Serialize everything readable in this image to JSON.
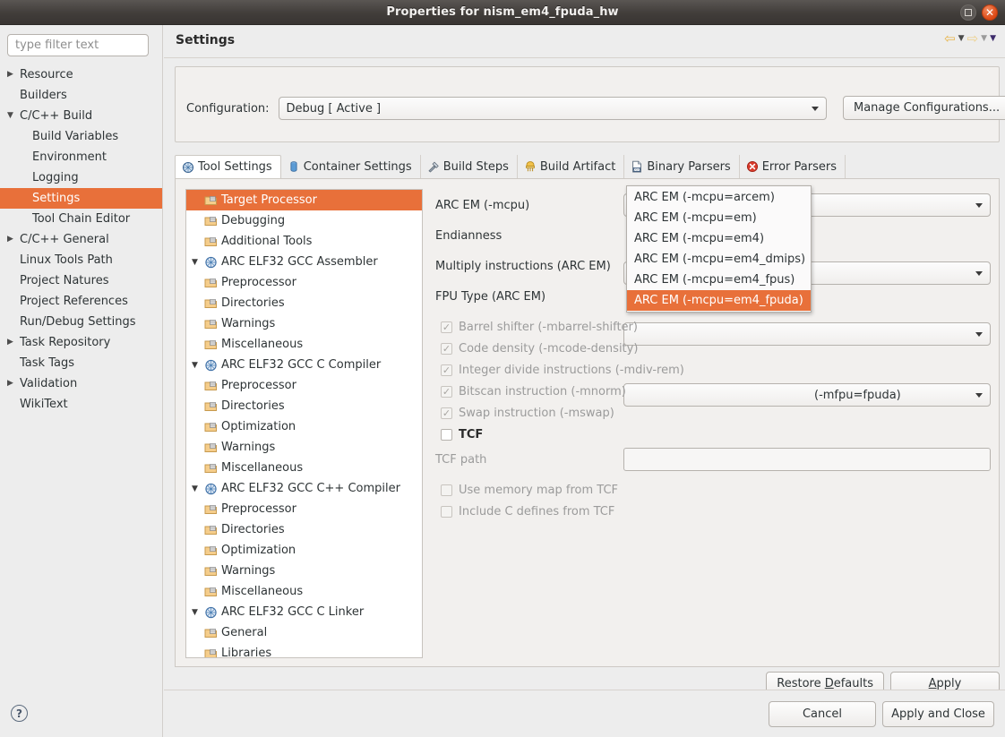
{
  "window": {
    "title": "Properties for nism_em4_fpuda_hw",
    "maximize_icon": "maximize-icon",
    "close_icon": "close-icon"
  },
  "sidebar": {
    "filter_placeholder": "type filter text",
    "filter_value": "",
    "items": [
      {
        "label": "Resource",
        "twisty": "▶",
        "indent": 0,
        "selected": false
      },
      {
        "label": "Builders",
        "twisty": "",
        "indent": 0,
        "selected": false
      },
      {
        "label": "C/C++ Build",
        "twisty": "▼",
        "indent": 0,
        "selected": false
      },
      {
        "label": "Build Variables",
        "twisty": "",
        "indent": 1,
        "selected": false
      },
      {
        "label": "Environment",
        "twisty": "",
        "indent": 1,
        "selected": false
      },
      {
        "label": "Logging",
        "twisty": "",
        "indent": 1,
        "selected": false
      },
      {
        "label": "Settings",
        "twisty": "",
        "indent": 1,
        "selected": true
      },
      {
        "label": "Tool Chain Editor",
        "twisty": "",
        "indent": 1,
        "selected": false
      },
      {
        "label": "C/C++ General",
        "twisty": "▶",
        "indent": 0,
        "selected": false
      },
      {
        "label": "Linux Tools Path",
        "twisty": "",
        "indent": 0,
        "selected": false
      },
      {
        "label": "Project Natures",
        "twisty": "",
        "indent": 0,
        "selected": false
      },
      {
        "label": "Project References",
        "twisty": "",
        "indent": 0,
        "selected": false
      },
      {
        "label": "Run/Debug Settings",
        "twisty": "",
        "indent": 0,
        "selected": false
      },
      {
        "label": "Task Repository",
        "twisty": "▶",
        "indent": 0,
        "selected": false
      },
      {
        "label": "Task Tags",
        "twisty": "",
        "indent": 0,
        "selected": false
      },
      {
        "label": "Validation",
        "twisty": "▶",
        "indent": 0,
        "selected": false
      },
      {
        "label": "WikiText",
        "twisty": "",
        "indent": 0,
        "selected": false
      }
    ],
    "help_icon": "help-icon",
    "help_glyph": "?"
  },
  "page": {
    "title": "Settings",
    "nav": [
      {
        "name": "back-arrow-icon",
        "glyph": "⇦"
      },
      {
        "name": "back-dropdown-icon",
        "glyph": "▼"
      },
      {
        "name": "forward-arrow-icon",
        "glyph": "⇨"
      },
      {
        "name": "forward-dropdown-icon",
        "glyph": "▼"
      },
      {
        "name": "view-menu-icon",
        "glyph": "▼"
      }
    ]
  },
  "configuration": {
    "label": "Configuration:",
    "value": "Debug  [ Active ]",
    "manage_button": "Manage Configurations..."
  },
  "tabs": [
    {
      "label": "Tool Settings",
      "icon": "tool-settings-icon",
      "active": true
    },
    {
      "label": "Container Settings",
      "icon": "container-settings-icon",
      "active": false
    },
    {
      "label": "Build Steps",
      "icon": "build-steps-icon",
      "active": false
    },
    {
      "label": "Build Artifact",
      "icon": "build-artifact-icon",
      "active": false
    },
    {
      "label": "Binary Parsers",
      "icon": "binary-parsers-icon",
      "active": false
    },
    {
      "label": "Error Parsers",
      "icon": "error-parsers-icon",
      "active": false
    }
  ],
  "tool_tree": [
    {
      "label": "Target Processor",
      "twisty": "",
      "icon": "folder-icon",
      "indent": 1,
      "selected": true
    },
    {
      "label": "Debugging",
      "twisty": "",
      "icon": "folder-icon",
      "indent": 1,
      "selected": false
    },
    {
      "label": "Additional Tools",
      "twisty": "",
      "icon": "folder-icon",
      "indent": 1,
      "selected": false
    },
    {
      "label": "ARC ELF32 GCC Assembler",
      "twisty": "▼",
      "icon": "tool-icon",
      "indent": 0,
      "selected": false
    },
    {
      "label": "Preprocessor",
      "twisty": "",
      "icon": "folder-icon",
      "indent": 1,
      "selected": false
    },
    {
      "label": "Directories",
      "twisty": "",
      "icon": "folder-icon",
      "indent": 1,
      "selected": false
    },
    {
      "label": "Warnings",
      "twisty": "",
      "icon": "folder-icon",
      "indent": 1,
      "selected": false
    },
    {
      "label": "Miscellaneous",
      "twisty": "",
      "icon": "folder-icon",
      "indent": 1,
      "selected": false
    },
    {
      "label": "ARC ELF32 GCC C Compiler",
      "twisty": "▼",
      "icon": "tool-icon",
      "indent": 0,
      "selected": false
    },
    {
      "label": "Preprocessor",
      "twisty": "",
      "icon": "folder-icon",
      "indent": 1,
      "selected": false
    },
    {
      "label": "Directories",
      "twisty": "",
      "icon": "folder-icon",
      "indent": 1,
      "selected": false
    },
    {
      "label": "Optimization",
      "twisty": "",
      "icon": "folder-icon",
      "indent": 1,
      "selected": false
    },
    {
      "label": "Warnings",
      "twisty": "",
      "icon": "folder-icon",
      "indent": 1,
      "selected": false
    },
    {
      "label": "Miscellaneous",
      "twisty": "",
      "icon": "folder-icon",
      "indent": 1,
      "selected": false
    },
    {
      "label": "ARC ELF32 GCC C++ Compiler",
      "twisty": "▼",
      "icon": "tool-icon",
      "indent": 0,
      "selected": false
    },
    {
      "label": "Preprocessor",
      "twisty": "",
      "icon": "folder-icon",
      "indent": 1,
      "selected": false
    },
    {
      "label": "Directories",
      "twisty": "",
      "icon": "folder-icon",
      "indent": 1,
      "selected": false
    },
    {
      "label": "Optimization",
      "twisty": "",
      "icon": "folder-icon",
      "indent": 1,
      "selected": false
    },
    {
      "label": "Warnings",
      "twisty": "",
      "icon": "folder-icon",
      "indent": 1,
      "selected": false
    },
    {
      "label": "Miscellaneous",
      "twisty": "",
      "icon": "folder-icon",
      "indent": 1,
      "selected": false
    },
    {
      "label": "ARC ELF32 GCC C Linker",
      "twisty": "▼",
      "icon": "tool-icon",
      "indent": 0,
      "selected": false
    },
    {
      "label": "General",
      "twisty": "",
      "icon": "folder-icon",
      "indent": 1,
      "selected": false
    },
    {
      "label": "Libraries",
      "twisty": "",
      "icon": "folder-icon",
      "indent": 1,
      "selected": false
    }
  ],
  "form": {
    "fields": [
      {
        "label": "ARC EM (-mcpu)",
        "value": "ARC EM (-mcpu=em4_fpuda)",
        "disabled": false
      },
      {
        "label": "Endianness",
        "value": "",
        "disabled": false
      },
      {
        "label": "Multiply instructions (ARC EM)",
        "value": "",
        "disabled": false
      },
      {
        "label": "FPU Type (ARC EM)",
        "value": "(-mfpu=fpuda)",
        "disabled": false
      }
    ],
    "checkboxes": [
      {
        "label": "Barrel shifter (-mbarrel-shifter)",
        "checked": true,
        "disabled": true
      },
      {
        "label": "Code density (-mcode-density)",
        "checked": true,
        "disabled": true
      },
      {
        "label": "Integer divide instructions (-mdiv-rem)",
        "checked": true,
        "disabled": true
      },
      {
        "label": "Bitscan instruction (-mnorm)",
        "checked": true,
        "disabled": true
      },
      {
        "label": "Swap instruction (-mswap)",
        "checked": true,
        "disabled": true
      },
      {
        "label": "TCF",
        "checked": false,
        "disabled": false
      }
    ],
    "tcf_path_label": "TCF path",
    "tcf_path_value": "",
    "tcf_checkboxes": [
      {
        "label": "Use memory map from TCF",
        "checked": false,
        "disabled": true
      },
      {
        "label": "Include C defines from TCF",
        "checked": false,
        "disabled": true
      }
    ]
  },
  "dropdown": {
    "open": true,
    "options": [
      {
        "label": "ARC EM (-mcpu=arcem)",
        "selected": false
      },
      {
        "label": "ARC EM (-mcpu=em)",
        "selected": false
      },
      {
        "label": "ARC EM (-mcpu=em4)",
        "selected": false
      },
      {
        "label": "ARC EM (-mcpu=em4_dmips)",
        "selected": false
      },
      {
        "label": "ARC EM (-mcpu=em4_fpus)",
        "selected": false
      },
      {
        "label": "ARC EM (-mcpu=em4_fpuda)",
        "selected": true
      }
    ]
  },
  "buttons": {
    "restore_defaults_pre": "Restore ",
    "restore_defaults_key": "D",
    "restore_defaults_post": "efaults",
    "apply_key": "A",
    "apply_post": "pply",
    "cancel": "Cancel",
    "apply_and_close": "Apply and Close"
  },
  "colors": {
    "accent_orange": "#e8703a",
    "titlebar_dark": "#413d3a",
    "close_red": "#dd4814",
    "panel_bg": "#ededed"
  }
}
